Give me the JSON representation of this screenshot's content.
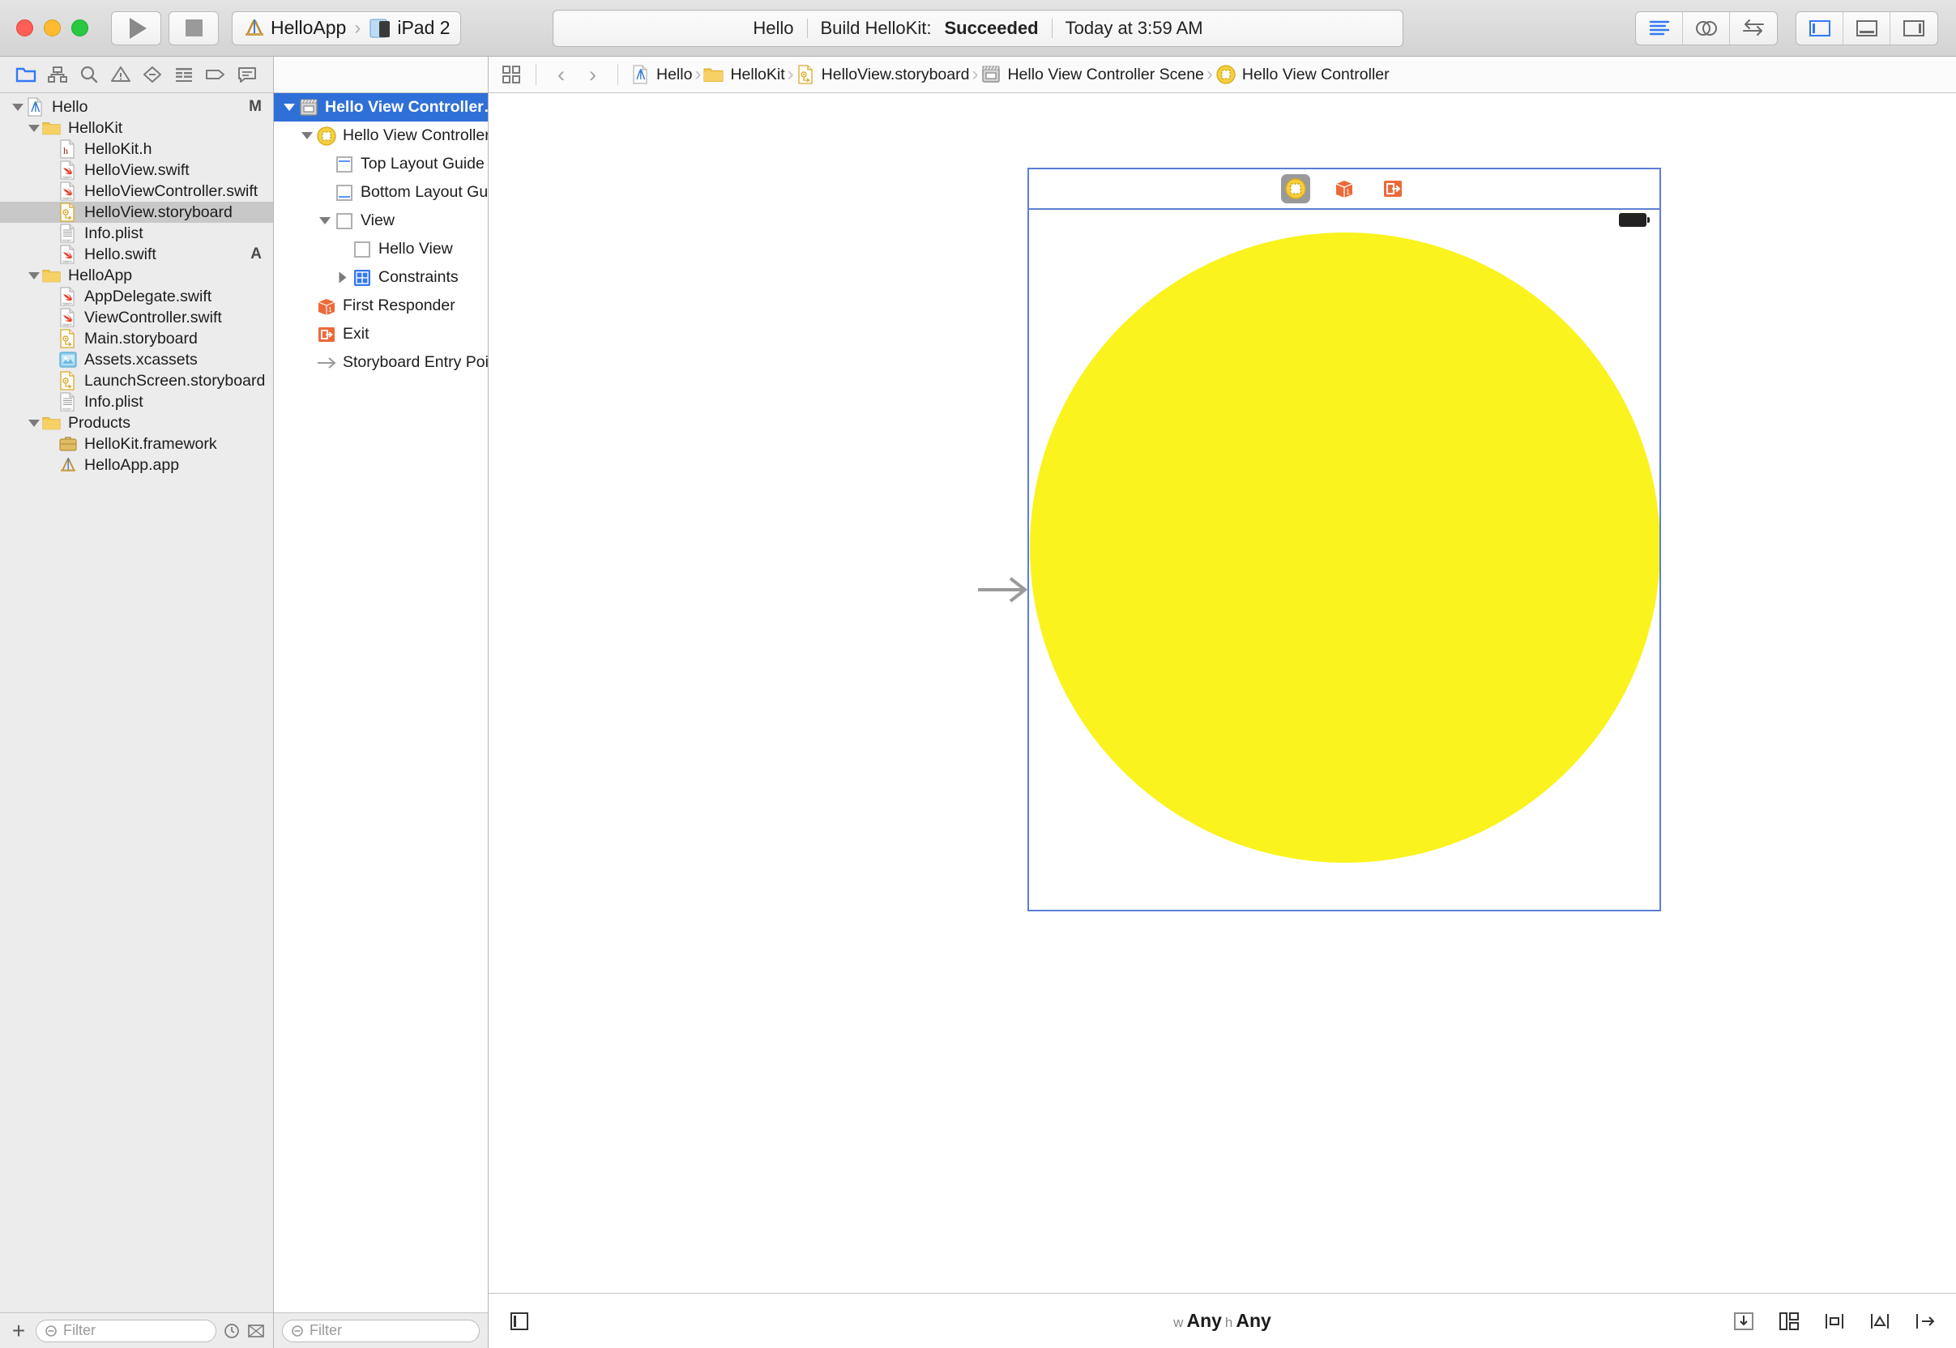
{
  "window": {
    "traffic_lights": [
      "close",
      "minimize",
      "zoom"
    ]
  },
  "toolbar": {
    "run_label": "Run",
    "stop_label": "Stop",
    "scheme_project": "HelloApp",
    "scheme_destination": "iPad 2",
    "status": {
      "project": "Hello",
      "action": "Build HelloKit:",
      "result": "Succeeded",
      "time": "Today at 3:59 AM"
    },
    "editor_modes": [
      "standard-editor",
      "assistant-editor",
      "version-editor"
    ],
    "view_toggles": [
      "navigator-toggle",
      "debug-area-toggle",
      "utilities-toggle"
    ]
  },
  "navigator": {
    "tabs": [
      "project-navigator",
      "symbol-navigator",
      "find-navigator",
      "issue-navigator",
      "test-navigator",
      "report-navigator",
      "breakpoint-navigator",
      "debug-navigator"
    ],
    "items": [
      {
        "label": "Hello",
        "indent": 0,
        "icon": "xcodeproj",
        "disclosure": "open",
        "badge": "M",
        "selected": false
      },
      {
        "label": "HelloKit",
        "indent": 1,
        "icon": "folder",
        "disclosure": "open",
        "badge": "",
        "selected": false
      },
      {
        "label": "HelloKit.h",
        "indent": 2,
        "icon": "header",
        "disclosure": "",
        "badge": "",
        "selected": false
      },
      {
        "label": "HelloView.swift",
        "indent": 2,
        "icon": "swift",
        "disclosure": "",
        "badge": "",
        "selected": false
      },
      {
        "label": "HelloViewController.swift",
        "indent": 2,
        "icon": "swift",
        "disclosure": "",
        "badge": "",
        "selected": false
      },
      {
        "label": "HelloView.storyboard",
        "indent": 2,
        "icon": "storyboard",
        "disclosure": "",
        "badge": "",
        "selected": true
      },
      {
        "label": "Info.plist",
        "indent": 2,
        "icon": "plist",
        "disclosure": "",
        "badge": "",
        "selected": false
      },
      {
        "label": "Hello.swift",
        "indent": 2,
        "icon": "swift",
        "disclosure": "",
        "badge": "A",
        "selected": false
      },
      {
        "label": "HelloApp",
        "indent": 1,
        "icon": "folder",
        "disclosure": "open",
        "badge": "",
        "selected": false
      },
      {
        "label": "AppDelegate.swift",
        "indent": 2,
        "icon": "swift",
        "disclosure": "",
        "badge": "",
        "selected": false
      },
      {
        "label": "ViewController.swift",
        "indent": 2,
        "icon": "swift",
        "disclosure": "",
        "badge": "",
        "selected": false
      },
      {
        "label": "Main.storyboard",
        "indent": 2,
        "icon": "storyboard",
        "disclosure": "",
        "badge": "",
        "selected": false
      },
      {
        "label": "Assets.xcassets",
        "indent": 2,
        "icon": "xcassets",
        "disclosure": "",
        "badge": "",
        "selected": false
      },
      {
        "label": "LaunchScreen.storyboard",
        "indent": 2,
        "icon": "storyboard",
        "disclosure": "",
        "badge": "",
        "selected": false
      },
      {
        "label": "Info.plist",
        "indent": 2,
        "icon": "plist",
        "disclosure": "",
        "badge": "",
        "selected": false
      },
      {
        "label": "Products",
        "indent": 1,
        "icon": "folder",
        "disclosure": "open",
        "badge": "",
        "selected": false
      },
      {
        "label": "HelloKit.framework",
        "indent": 2,
        "icon": "framework",
        "disclosure": "",
        "badge": "",
        "selected": false
      },
      {
        "label": "HelloApp.app",
        "indent": 2,
        "icon": "app",
        "disclosure": "",
        "badge": "",
        "selected": false
      }
    ],
    "filter_placeholder": "Filter",
    "add_button_label": "+"
  },
  "outline": {
    "items": [
      {
        "label": "Hello View Controller…",
        "indent": 0,
        "icon": "scene",
        "disclosure": "open",
        "selected": true
      },
      {
        "label": "Hello View Controller",
        "indent": 1,
        "icon": "viewcontroller",
        "disclosure": "open",
        "selected": false
      },
      {
        "label": "Top Layout Guide",
        "indent": 2,
        "icon": "top-guide",
        "disclosure": "",
        "selected": false
      },
      {
        "label": "Bottom Layout Gu…",
        "indent": 2,
        "icon": "bottom-guide",
        "disclosure": "",
        "selected": false
      },
      {
        "label": "View",
        "indent": 2,
        "icon": "view",
        "disclosure": "open",
        "selected": false
      },
      {
        "label": "Hello View",
        "indent": 3,
        "icon": "view",
        "disclosure": "",
        "selected": false
      },
      {
        "label": "Constraints",
        "indent": 3,
        "icon": "constraints",
        "disclosure": "closed",
        "selected": false
      },
      {
        "label": "First Responder",
        "indent": 1,
        "icon": "responder",
        "disclosure": "",
        "selected": false
      },
      {
        "label": "Exit",
        "indent": 1,
        "icon": "exit",
        "disclosure": "",
        "selected": false
      },
      {
        "label": "Storyboard Entry Point",
        "indent": 1,
        "icon": "entry-arrow",
        "disclosure": "",
        "selected": false
      }
    ],
    "filter_placeholder": "Filter"
  },
  "jumpbar": {
    "crumbs": [
      {
        "label": "Hello",
        "icon": "xcodeproj"
      },
      {
        "label": "HelloKit",
        "icon": "folder"
      },
      {
        "label": "HelloView.storyboard",
        "icon": "storyboard"
      },
      {
        "label": "Hello View Controller Scene",
        "icon": "scene"
      },
      {
        "label": "Hello View Controller",
        "icon": "viewcontroller"
      }
    ],
    "back_label": "‹",
    "forward_label": "›"
  },
  "canvas": {
    "scene_dock_icons": [
      "view-controller-icon",
      "first-responder-icon",
      "exit-icon"
    ],
    "shape_color": "#faf31e",
    "selection_color": "#5b7fd4"
  },
  "canvas_bottom": {
    "size_class_w_prefix": "w",
    "size_class_w": "Any",
    "size_class_h_prefix": "h",
    "size_class_h": "Any",
    "tools": [
      "document-outline-toggle",
      "auto-layout-update-frames",
      "auto-layout-embed",
      "auto-layout-align",
      "auto-layout-pin",
      "auto-layout-resolve"
    ]
  }
}
